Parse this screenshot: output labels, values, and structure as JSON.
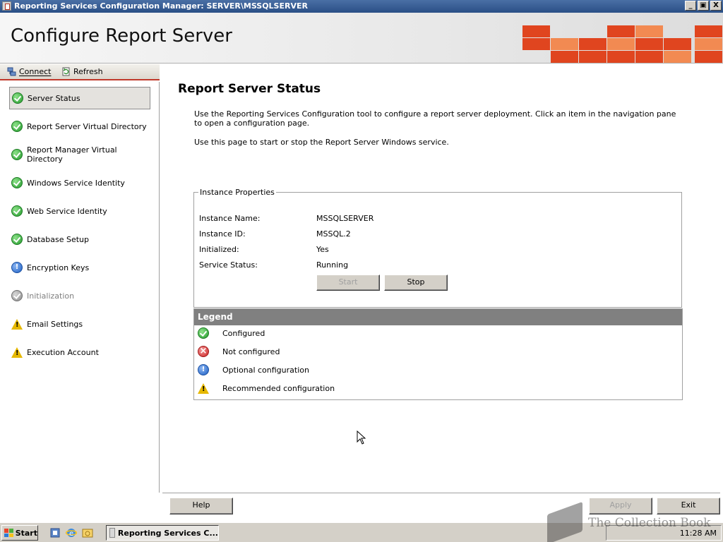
{
  "window": {
    "title": "Reporting Services Configuration Manager: SERVER\\MSSQLSERVER",
    "minimize": "_",
    "maximize": "▣",
    "close": "X"
  },
  "header": {
    "title": "Configure Report Server"
  },
  "toolbar": {
    "connect_label": "Connect",
    "refresh_label": "Refresh"
  },
  "nav": {
    "items": [
      {
        "label": "Server Status",
        "status": "configured"
      },
      {
        "label": "Report Server Virtual Directory",
        "status": "configured"
      },
      {
        "label": "Report Manager Virtual Directory",
        "status": "configured"
      },
      {
        "label": "Windows Service Identity",
        "status": "configured"
      },
      {
        "label": "Web Service Identity",
        "status": "configured"
      },
      {
        "label": "Database Setup",
        "status": "configured"
      },
      {
        "label": "Encryption Keys",
        "status": "optional"
      },
      {
        "label": "Initialization",
        "status": "disabled"
      },
      {
        "label": "Email Settings",
        "status": "recommended"
      },
      {
        "label": "Execution Account",
        "status": "recommended"
      }
    ]
  },
  "main": {
    "title": "Report Server Status",
    "intro": "Use the Reporting Services Configuration tool to configure a report server deployment. Click an item in the navigation pane to open a configuration page.",
    "instructions": "Use this page to start or stop the Report Server Windows service.",
    "instance": {
      "group_label": "Instance Properties",
      "name_label": "Instance Name:",
      "name_value": "MSSQLSERVER",
      "id_label": "Instance ID:",
      "id_value": "MSSQL.2",
      "initialized_label": "Initialized:",
      "initialized_value": "Yes",
      "service_status_label": "Service Status:",
      "service_status_value": "Running",
      "start_label": "Start",
      "stop_label": "Stop"
    },
    "legend": {
      "heading": "Legend",
      "configured": "Configured",
      "not_configured": "Not configured",
      "optional": "Optional configuration",
      "recommended": "Recommended configuration"
    }
  },
  "footer": {
    "help_label": "Help",
    "apply_label": "Apply",
    "exit_label": "Exit"
  },
  "taskbar": {
    "start_label": "Start",
    "task_label": "Reporting Services C...",
    "clock": "11:28 AM"
  },
  "watermark": {
    "text": "The Collection Book"
  },
  "colors": {
    "accent_red": "#c0392b",
    "tile_red": "#e0451f",
    "tile_orange": "#f28a52",
    "status_ok": "#22992b",
    "status_info": "#1d5fc4",
    "status_error": "#cc2222",
    "status_warning": "#e6b800"
  }
}
